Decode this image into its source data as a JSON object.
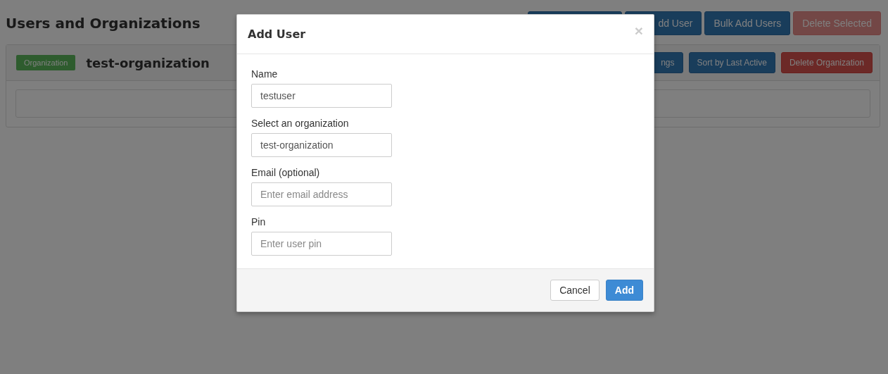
{
  "page": {
    "title": "Users and Organizations",
    "toolbar": [
      {
        "kind": "primary",
        "disabled": false
      },
      {
        "label": "dd User",
        "kind": "primary",
        "disabled": false
      },
      {
        "label": "Bulk Add Users",
        "kind": "primary",
        "disabled": false
      },
      {
        "label": "Delete Selected",
        "kind": "danger",
        "disabled": true
      }
    ],
    "organization": {
      "badge": "Organization",
      "name": "test-organization",
      "buttons": [
        {
          "label": "ngs",
          "kind": "primary"
        },
        {
          "label": "Sort by Last Active",
          "kind": "primary"
        },
        {
          "label": "Delete Organization",
          "kind": "danger"
        }
      ]
    }
  },
  "modal": {
    "title": "Add User",
    "close": "×",
    "fields": [
      {
        "label": "Name",
        "value": "testuser"
      },
      {
        "label": "Select an organization",
        "value": "test-organization"
      },
      {
        "label": "Email (optional)",
        "placeholder": "Enter email address"
      },
      {
        "label": "Pin",
        "placeholder": "Enter user pin"
      }
    ],
    "buttons": [
      {
        "label": "Cancel",
        "kind": "default"
      },
      {
        "label": "Add",
        "kind": "primary"
      }
    ]
  }
}
